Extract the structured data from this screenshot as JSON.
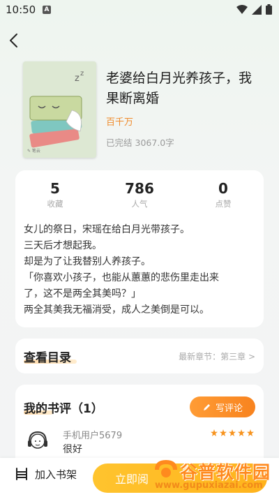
{
  "status_bar": {
    "time": "10:50",
    "notification_icon": "A"
  },
  "book": {
    "title_line1": "老婆给白月光养孩子，我",
    "title_line2": "果断离婚",
    "author": "百千万",
    "status": "已完结",
    "word_count": "3067.0字"
  },
  "stats": {
    "favorites": {
      "value": "5",
      "label": "收藏"
    },
    "popularity": {
      "value": "786",
      "label": "人气"
    },
    "likes": {
      "value": "0",
      "label": "点赞"
    }
  },
  "synopsis": [
    "女儿的祭日，宋瑶在给白月光带孩子。",
    "三天后才想起我。",
    "却是为了让我替别人养孩子。",
    "「你喜欢小孩子，也能从蕙蕙的悲伤里走出来",
    "了，这不是两全其美吗？」",
    "两全其美我无福消受，成人之美倒是可以。"
  ],
  "toc": {
    "title": "查看目录",
    "latest": "最新章节：第三章 >"
  },
  "reviews": {
    "title": "我的书评（1）",
    "write_label": "写评论",
    "items": [
      {
        "user": "手机用户5679",
        "text": "很好",
        "stars": 5
      }
    ]
  },
  "bottom_bar": {
    "shelf_label": "加入书架",
    "read_label": "立即阅"
  },
  "watermark": {
    "name": "谷普软件园",
    "url": "www.gupuxiazai.com"
  },
  "colors": {
    "accent": "#f08a2a",
    "read_button": "#ffb31c",
    "star": "#f7931e"
  }
}
